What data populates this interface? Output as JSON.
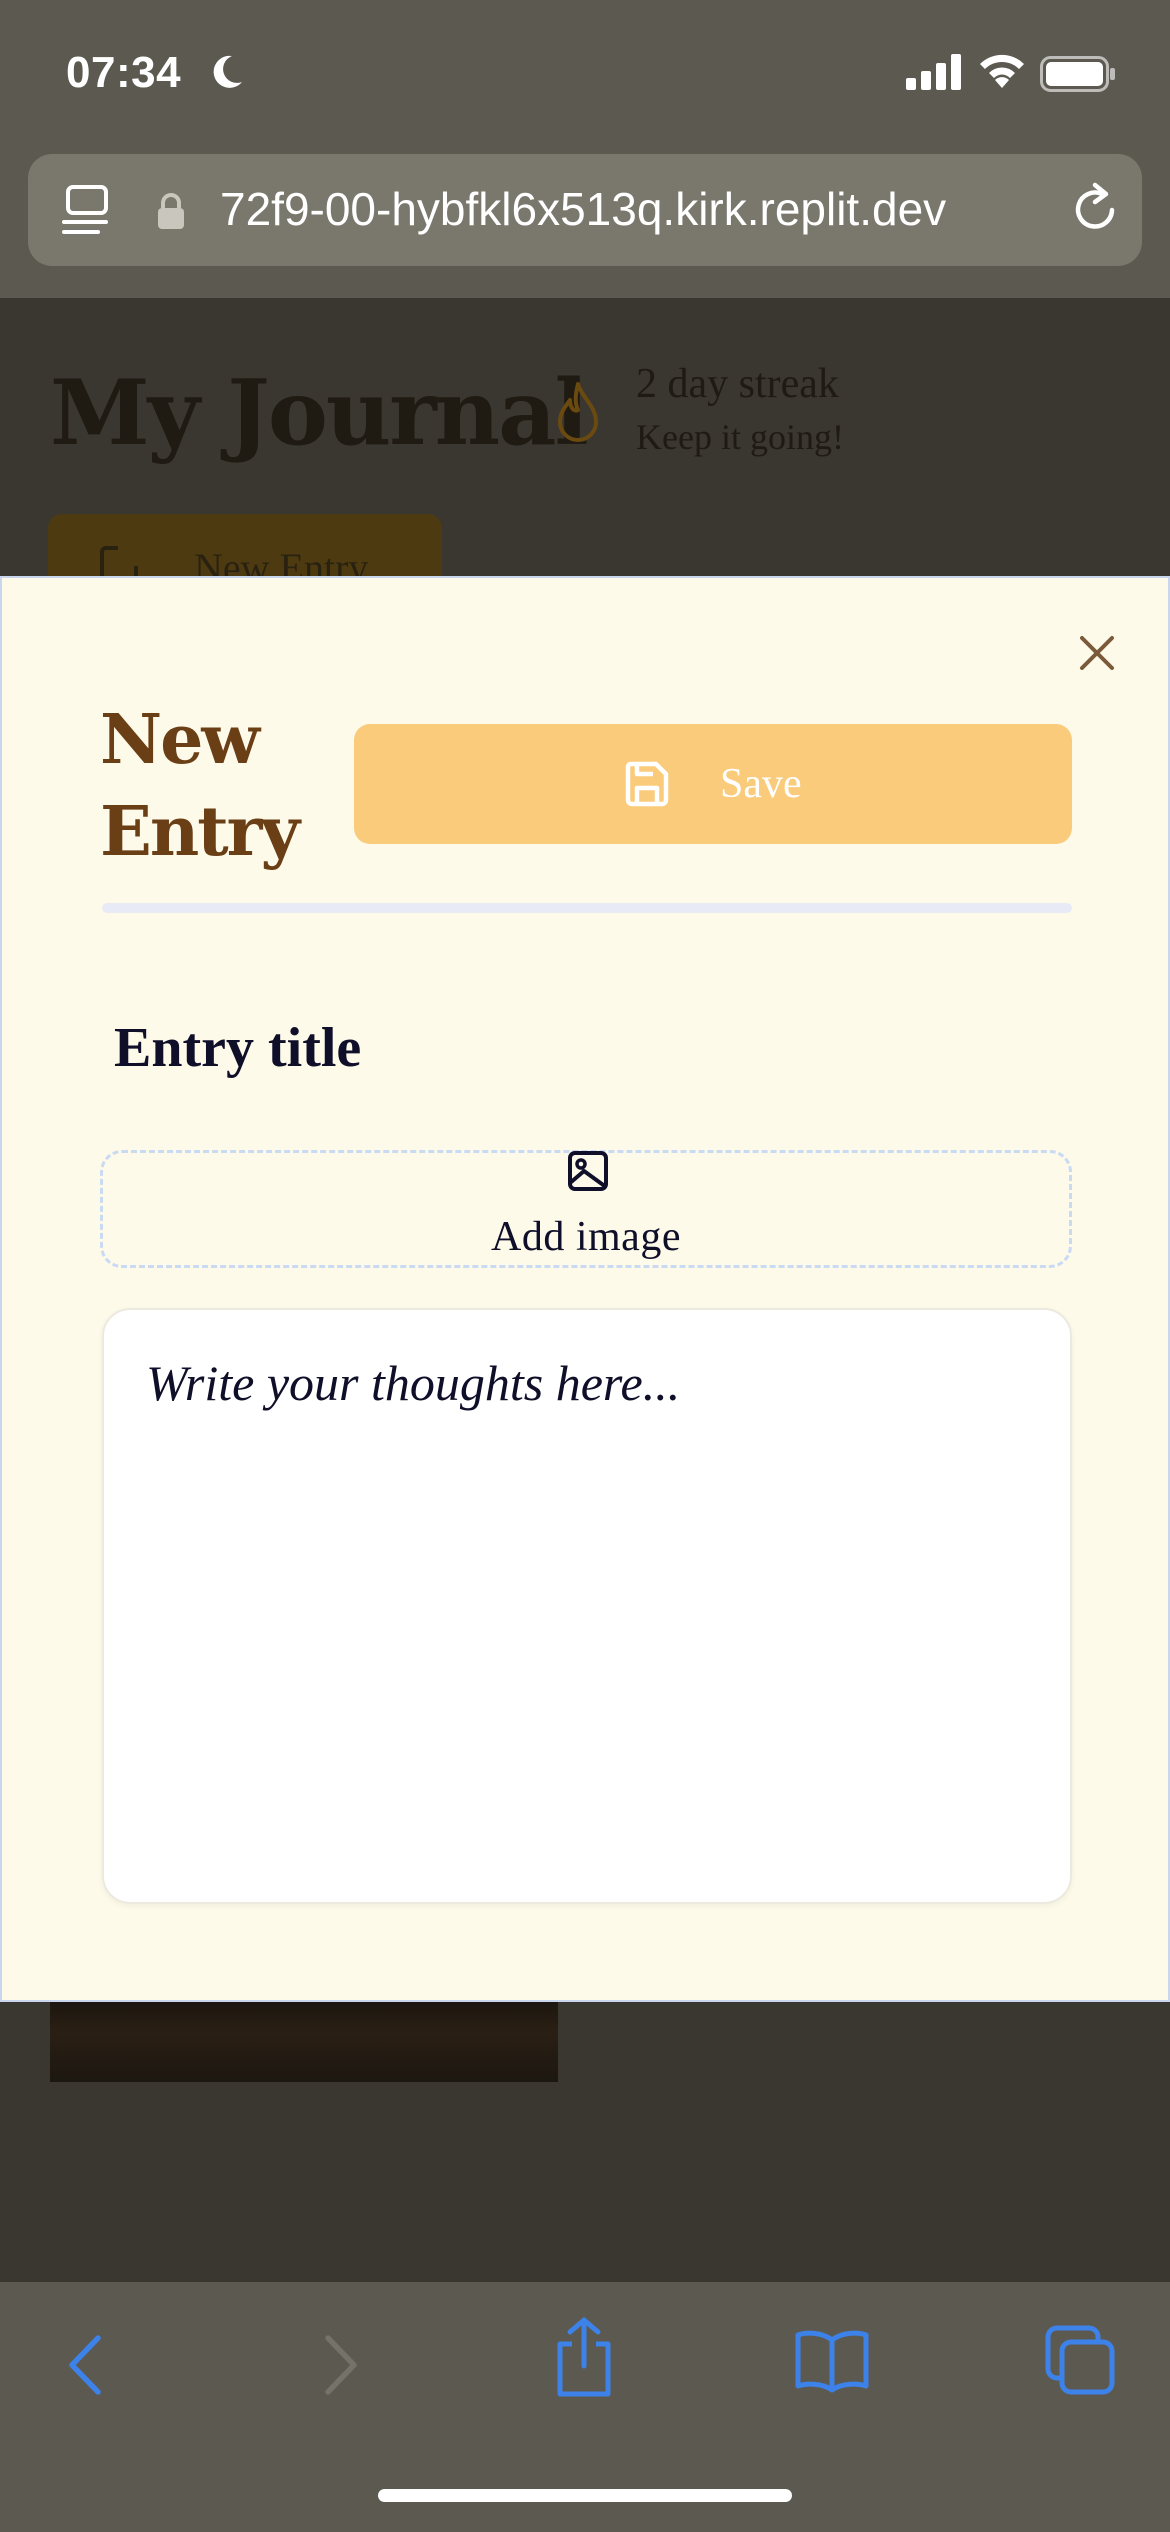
{
  "status_bar": {
    "time": "07:34"
  },
  "url_bar": {
    "url": "72f9-00-hybfkl6x513q.kirk.replit.dev"
  },
  "background_page": {
    "title": "My Journal",
    "streak": "2 day streak",
    "streak_sub": "Keep it going!",
    "new_entry_button": "New Entry"
  },
  "modal": {
    "title": "New Entry",
    "save_label": "Save",
    "entry_title_placeholder": "Entry title",
    "add_image_label": "Add image",
    "body_placeholder": "Write your thoughts here..."
  },
  "colors": {
    "modal_bg": "#fefaea",
    "title_brown": "#6b3f15",
    "save_button": "#f9cb7a",
    "safari_blue": "#3d82e8"
  },
  "icons": {
    "save": "save-icon",
    "close": "close-icon",
    "image": "image-icon",
    "flame": "flame-icon",
    "nav": [
      "home-icon",
      "edit-icon",
      "book-icon",
      "settings-icon"
    ],
    "toolbar": [
      "back-icon",
      "forward-icon",
      "share-icon",
      "bookmarks-icon",
      "tabs-icon"
    ]
  }
}
